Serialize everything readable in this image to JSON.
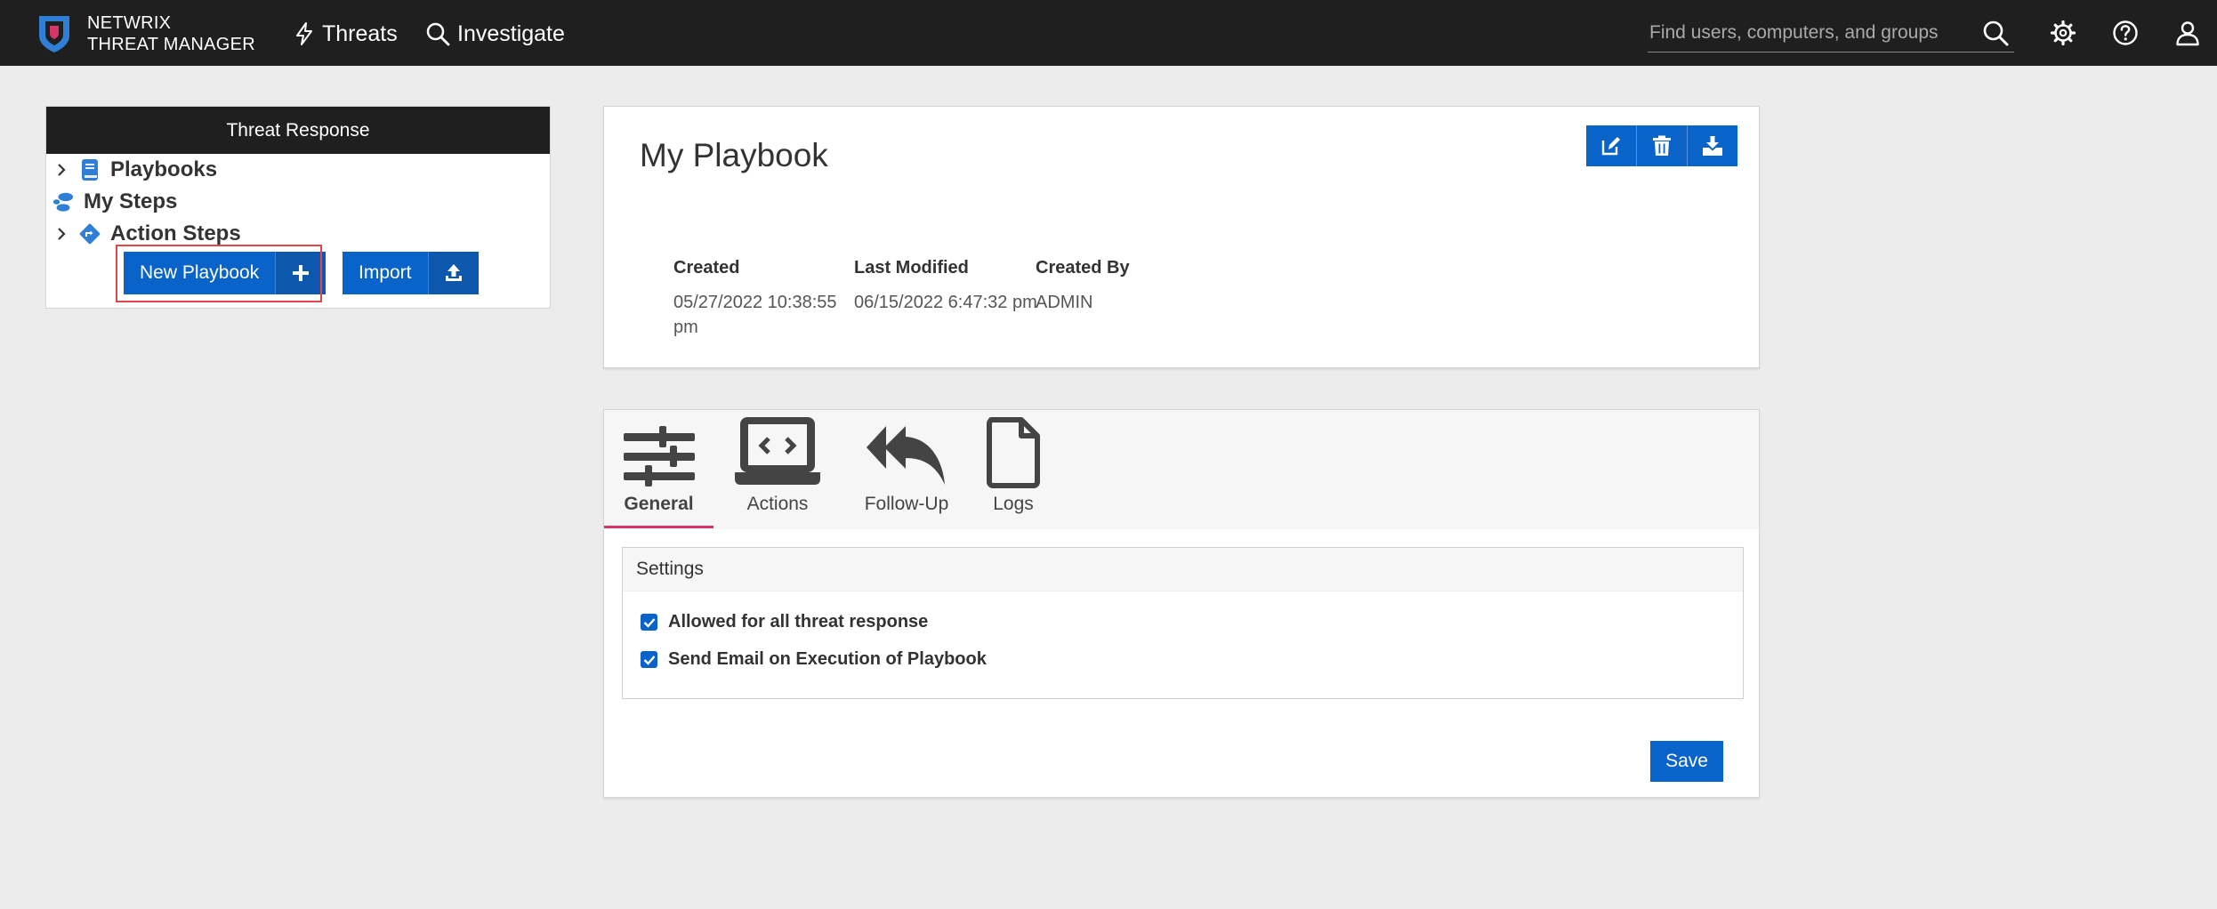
{
  "brand": {
    "line1": "NETWRIX",
    "line2": "THREAT MANAGER"
  },
  "nav": {
    "threats": "Threats",
    "investigate": "Investigate"
  },
  "search": {
    "placeholder": "Find users, computers, and groups"
  },
  "colors": {
    "accent": "#0a63c9",
    "topbar": "#1f1f1f",
    "active_tab": "#d8356a",
    "highlight": "#e0474c"
  },
  "left_panel": {
    "title": "Threat Response",
    "items": [
      {
        "label": "Playbooks",
        "icon": "book-icon",
        "expandable": true
      },
      {
        "label": "My Steps",
        "icon": "footsteps-icon",
        "expandable": false
      },
      {
        "label": "Action Steps",
        "icon": "diamond-arrow-icon",
        "expandable": true
      }
    ],
    "new_playbook": "New Playbook",
    "import": "Import"
  },
  "playbook": {
    "title": "My Playbook",
    "created_label": "Created",
    "created_value": "05/27/2022 10:38:55 pm",
    "modified_label": "Last Modified",
    "modified_value": "06/15/2022 6:47:32 pm",
    "createdby_label": "Created By",
    "createdby_value": "ADMIN",
    "toolbar_icons": [
      "edit-icon",
      "trash-icon",
      "download-icon"
    ]
  },
  "tabs": [
    {
      "label": "General",
      "icon": "sliders-icon",
      "active": true
    },
    {
      "label": "Actions",
      "icon": "laptop-code-icon",
      "active": false
    },
    {
      "label": "Follow-Up",
      "icon": "reply-all-icon",
      "active": false
    },
    {
      "label": "Logs",
      "icon": "file-icon",
      "active": false
    }
  ],
  "settings": {
    "title": "Settings",
    "options": [
      {
        "label": "Allowed for all threat response",
        "checked": true
      },
      {
        "label": "Send Email on Execution of Playbook",
        "checked": true
      }
    ],
    "save": "Save"
  }
}
